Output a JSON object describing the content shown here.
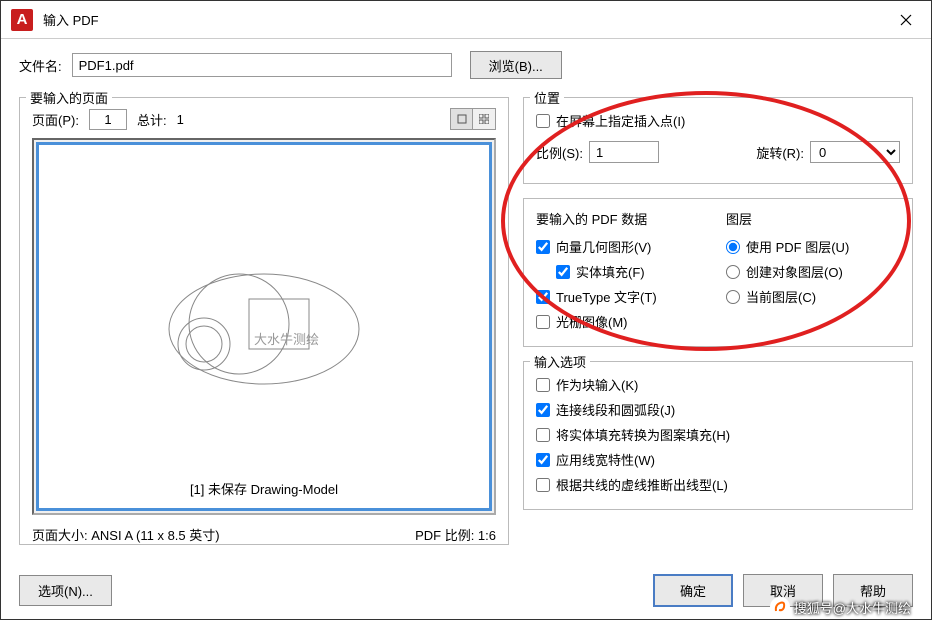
{
  "window": {
    "app_icon": "A",
    "title": "输入 PDF"
  },
  "filename": {
    "label": "文件名:",
    "value": "PDF1.pdf",
    "browse": "浏览(B)..."
  },
  "pages_group": {
    "title": "要输入的页面",
    "page_label": "页面(P):",
    "page_value": "1",
    "total_label": "总计:",
    "total_value": "1",
    "preview_caption": "[1] 未保存 Drawing-Model",
    "page_size": "页面大小: ANSI A (11 x 8.5 英寸)",
    "pdf_scale": "PDF 比例: 1:6"
  },
  "location": {
    "title": "位置",
    "specify_onscreen": "在屏幕上指定插入点(I)",
    "scale_label": "比例(S):",
    "scale_value": "1",
    "rotation_label": "旋转(R):",
    "rotation_value": "0"
  },
  "import_data": {
    "title": "要输入的 PDF 数据",
    "vector": "向量几何图形(V)",
    "solid_fill": "实体填充(F)",
    "truetype": "TrueType 文字(T)",
    "raster": "光栅图像(M)"
  },
  "layers": {
    "title": "图层",
    "use_pdf": "使用 PDF 图层(U)",
    "create_obj": "创建对象图层(O)",
    "current": "当前图层(C)"
  },
  "options": {
    "title": "输入选项",
    "as_block": "作为块输入(K)",
    "join_lines": "连接线段和圆弧段(J)",
    "convert_fill": "将实体填充转换为图案填充(H)",
    "apply_lw": "应用线宽特性(W)",
    "infer_lt": "根据共线的虚线推断出线型(L)"
  },
  "footer": {
    "options_btn": "选项(N)...",
    "ok": "确定",
    "cancel": "取消",
    "help": "帮助"
  },
  "watermark": "搜狐号@大水牛测绘"
}
